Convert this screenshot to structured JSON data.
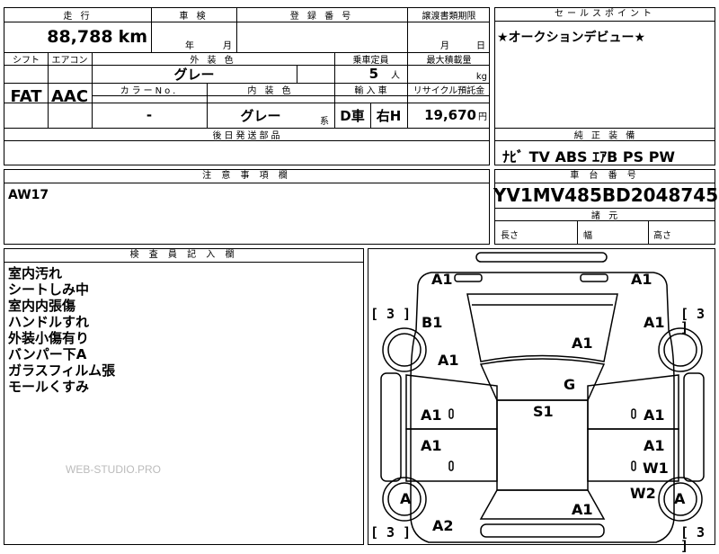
{
  "header": {
    "mileage_label": "走 行",
    "inspection_label": "車 検",
    "registration_label": "登 録 番 号",
    "transfer_label": "譲渡書類期限",
    "sales_point_label": "セールスポイント",
    "mileage_value": "88,788",
    "mileage_unit": "km",
    "insp_year_unit": "年",
    "insp_month_unit": "月",
    "transfer_month_unit": "月",
    "transfer_day_unit": "日",
    "sales_point_value": "★オークションデビュー★"
  },
  "specs": {
    "shift_label": "シフト",
    "ac_label": "エアコン",
    "exterior_color_label": "外 装 色",
    "capacity_label": "乗車定員",
    "max_load_label": "最大積載量",
    "shift_value": "FAT",
    "ac_value": "AAC",
    "exterior_color_value": "グレー",
    "capacity_value": "5",
    "capacity_unit": "人",
    "max_load_unit": "kg",
    "color_no_label": "カラーNo.",
    "interior_color_label": "内 装 色",
    "import_label": "輸 入 車",
    "recycle_label": "リサイクル預託金",
    "color_no_value": "-",
    "interior_color_value": "グレー",
    "interior_color_suffix": "系",
    "import_dealer": "D車",
    "import_handle": "右H",
    "recycle_value": "19,670",
    "recycle_unit": "円",
    "later_parts_label": "後日発送部品"
  },
  "equipment": {
    "label": "純 正 装 備",
    "value": "ﾅﾋﾞ TV ABS ｴｱB PS PW"
  },
  "notes": {
    "label": "注 意 事 項 欄",
    "value": "AW17"
  },
  "vin": {
    "label": "車 台 番 号",
    "value": "YV1MV485BD2048745",
    "dims_label": "諸 元",
    "length_label": "長さ",
    "width_label": "幅",
    "height_label": "高さ"
  },
  "inspector": {
    "label": "検 査 員 記 入 欄",
    "lines": [
      "室内汚れ",
      "シートしみ中",
      "室内内張傷",
      "ハンドルすれ",
      "外装小傷有り",
      "バンパー下A",
      "ガラスフィルム張",
      "モールくすみ"
    ],
    "watermark": "WEB-STUDIO.PRO"
  },
  "diagram": {
    "marks": [
      "A1",
      "A1",
      "A1",
      "A1",
      "B1",
      "A1",
      "A1",
      "G",
      "S1",
      "A1",
      "A1",
      "A1",
      "A1",
      "W1",
      "W2",
      "A",
      "A",
      "A1",
      "A2"
    ],
    "brackets": [
      "[ 3 ]",
      "[ 3 ]",
      "[ 3 ]",
      "[ 3 ]"
    ]
  }
}
